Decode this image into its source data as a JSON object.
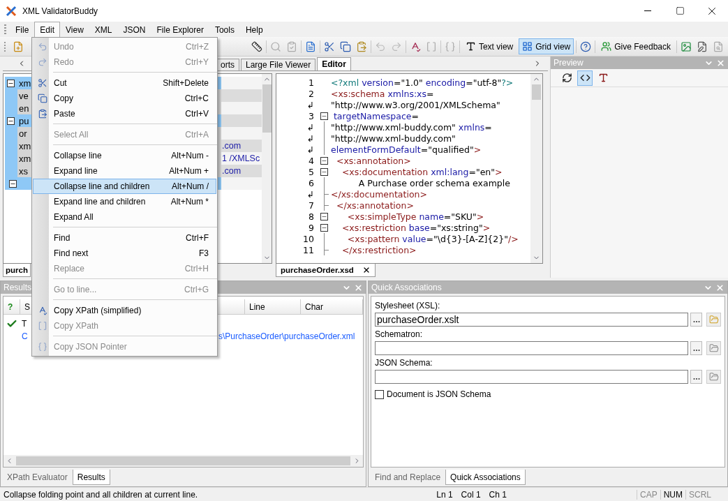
{
  "window": {
    "title": "XML ValidatorBuddy"
  },
  "menu_bar": [
    {
      "label": "File",
      "selected": false
    },
    {
      "label": "Edit",
      "selected": true
    },
    {
      "label": "View",
      "selected": false
    },
    {
      "label": "XML",
      "selected": false
    },
    {
      "label": "JSON",
      "selected": false
    },
    {
      "label": "File Explorer",
      "selected": false
    },
    {
      "label": "Tools",
      "selected": false
    },
    {
      "label": "Help",
      "selected": false
    }
  ],
  "edit_menu": {
    "items": [
      {
        "kind": "item",
        "label": "Undo",
        "shortcut": "Ctrl+Z",
        "disabled": true,
        "selected": false
      },
      {
        "kind": "item",
        "label": "Redo",
        "shortcut": "Ctrl+Y",
        "disabled": true,
        "selected": false
      },
      {
        "kind": "separator"
      },
      {
        "kind": "item",
        "label": "Cut",
        "shortcut": "Shift+Delete",
        "disabled": false,
        "selected": false
      },
      {
        "kind": "item",
        "label": "Copy",
        "shortcut": "Ctrl+C",
        "disabled": false,
        "selected": false
      },
      {
        "kind": "item",
        "label": "Paste",
        "shortcut": "Ctrl+V",
        "disabled": false,
        "selected": false
      },
      {
        "kind": "separator"
      },
      {
        "kind": "item",
        "label": "Select All",
        "shortcut": "Ctrl+A",
        "disabled": true,
        "selected": false
      },
      {
        "kind": "separator"
      },
      {
        "kind": "item",
        "label": "Collapse line",
        "shortcut": "Alt+Num -",
        "disabled": false,
        "selected": false
      },
      {
        "kind": "item",
        "label": "Expand line",
        "shortcut": "Alt+Num +",
        "disabled": false,
        "selected": false
      },
      {
        "kind": "item",
        "label": "Collapse line and children",
        "shortcut": "Alt+Num /",
        "disabled": false,
        "selected": true
      },
      {
        "kind": "item",
        "label": "Expand line and children",
        "shortcut": "Alt+Num *",
        "disabled": false,
        "selected": false
      },
      {
        "kind": "item",
        "label": "Expand All",
        "disabled": false,
        "selected": false
      },
      {
        "kind": "separator"
      },
      {
        "kind": "item",
        "label": "Find",
        "shortcut": "Ctrl+F",
        "disabled": false,
        "selected": false
      },
      {
        "kind": "item",
        "label": "Find next",
        "shortcut": "F3",
        "disabled": false,
        "selected": false
      },
      {
        "kind": "item",
        "label": "Replace",
        "shortcut": "Ctrl+H",
        "disabled": true,
        "selected": false
      },
      {
        "kind": "separator"
      },
      {
        "kind": "item",
        "label": "Go to line...",
        "shortcut": "Ctrl+G",
        "disabled": true,
        "selected": false
      },
      {
        "kind": "separator"
      },
      {
        "kind": "item",
        "label": "Copy XPath (simplified)",
        "disabled": false,
        "selected": false
      },
      {
        "kind": "item",
        "label": "Copy XPath",
        "disabled": true,
        "selected": false
      },
      {
        "kind": "separator"
      },
      {
        "kind": "item",
        "label": "Copy JSON Pointer",
        "disabled": true,
        "selected": false
      }
    ]
  },
  "toolbar": {
    "buttons": [
      {
        "label": "Text view",
        "pressed": false
      },
      {
        "label": "Grid view",
        "pressed": true
      },
      {
        "label": "Give Feedback",
        "pressed": false
      }
    ]
  },
  "document_tabs": [
    {
      "label": "orts",
      "selected": false
    },
    {
      "label": "Large File Viewer",
      "selected": false
    },
    {
      "label": "Editor",
      "selected": true
    }
  ],
  "grid": {
    "tab": "purch",
    "rows": [
      {
        "kind": "element",
        "name": "xm",
        "expanded": true
      },
      {
        "kind": "attribute",
        "name": "ve"
      },
      {
        "kind": "attribute",
        "name": "en"
      },
      {
        "kind": "element",
        "name": "pu",
        "expanded": true
      },
      {
        "kind": "attribute",
        "name": "or"
      },
      {
        "kind": "attribute",
        "name": "xm",
        "value": ".com"
      },
      {
        "kind": "attribute",
        "name": "xm",
        "value": "1 /XMLSc"
      },
      {
        "kind": "attribute",
        "name": "xs",
        "value": ".com"
      },
      {
        "kind": "element",
        "expanded": true
      }
    ]
  },
  "editor": {
    "tab": "purchaseOrder.xsd",
    "lines": [
      {
        "number": "1",
        "kind": "plain",
        "segments": [
          {
            "kind": "pi",
            "text": "<?xml"
          },
          {
            "kind": "attr",
            "text": " version"
          },
          {
            "kind": "value",
            "text": "=\"1.0\""
          },
          {
            "kind": "attr",
            "text": " encoding"
          },
          {
            "kind": "value",
            "text": "=\"utf-8\""
          },
          {
            "kind": "pi",
            "text": "?>"
          }
        ]
      },
      {
        "number": "2",
        "kind": "plain",
        "segments": [
          {
            "kind": "tag",
            "text": "<xs:schema"
          },
          {
            "kind": "attr",
            "text": " xmlns:xs"
          },
          {
            "kind": "value",
            "text": "="
          }
        ]
      },
      {
        "number": "↲",
        "kind": "plain",
        "segments": [
          {
            "kind": "value",
            "text": "\"http://www.w3.org/2001/XMLSchema\""
          }
        ]
      },
      {
        "number": "3",
        "kind": "fold",
        "segments": [
          {
            "kind": "attr",
            "text": " targetNamespace"
          },
          {
            "kind": "value",
            "text": "="
          }
        ]
      },
      {
        "number": "↲",
        "kind": "inner",
        "segments": [
          {
            "kind": "value",
            "text": "\"http://www.xml-buddy.com\""
          },
          {
            "kind": "attr",
            "text": " xmlns"
          },
          {
            "kind": "value",
            "text": "="
          }
        ]
      },
      {
        "number": "↲",
        "kind": "inner",
        "segments": [
          {
            "kind": "value",
            "text": "\"http://www.xml-buddy.com\""
          }
        ]
      },
      {
        "number": "↲",
        "kind": "inner",
        "segments": [
          {
            "kind": "attr",
            "text": "elementFormDefault"
          },
          {
            "kind": "value",
            "text": "=\"qualified\""
          },
          {
            "kind": "tag",
            "text": ">"
          }
        ]
      },
      {
        "number": "4",
        "kind": "fold",
        "segments": [
          {
            "kind": "tag",
            "text": "  <xs:annotation>"
          }
        ]
      },
      {
        "number": "5",
        "kind": "fold",
        "segments": [
          {
            "kind": "tag",
            "text": "    <xs:documentation"
          },
          {
            "kind": "attr",
            "text": " xml:lang"
          },
          {
            "kind": "value",
            "text": "=\"en\""
          },
          {
            "kind": "tag",
            "text": ">"
          }
        ]
      },
      {
        "number": "6",
        "kind": "inner",
        "segments": [
          {
            "kind": "value",
            "text": "          A Purchase order schema example"
          }
        ]
      },
      {
        "number": "↲",
        "kind": "end",
        "segments": [
          {
            "kind": "tag",
            "text": "</xs:documentation>"
          }
        ]
      },
      {
        "number": "7",
        "kind": "end",
        "segments": [
          {
            "kind": "tag",
            "text": "  </xs:annotation>"
          }
        ]
      },
      {
        "number": "8",
        "kind": "fold",
        "segments": [
          {
            "kind": "tag",
            "text": "      <xs:simpleType"
          },
          {
            "kind": "attr",
            "text": " name"
          },
          {
            "kind": "value",
            "text": "=\"SKU\""
          },
          {
            "kind": "tag",
            "text": ">"
          }
        ]
      },
      {
        "number": "9",
        "kind": "fold",
        "segments": [
          {
            "kind": "tag",
            "text": "    <xs:restriction"
          },
          {
            "kind": "attr",
            "text": " base"
          },
          {
            "kind": "value",
            "text": "=\"xs:string\""
          },
          {
            "kind": "tag",
            "text": ">"
          }
        ]
      },
      {
        "number": "10",
        "kind": "inner",
        "segments": [
          {
            "kind": "tag",
            "text": "      <xs:pattern"
          },
          {
            "kind": "attr",
            "text": " value"
          },
          {
            "kind": "value",
            "text": "=\"\\d{3}-[A-Z]{2}\""
          },
          {
            "kind": "tag",
            "text": "/>"
          }
        ]
      },
      {
        "number": "11",
        "kind": "end",
        "segments": [
          {
            "kind": "tag",
            "text": "    </xs:restriction>"
          }
        ]
      }
    ]
  },
  "preview": {
    "title": "Preview",
    "buttons": [
      {
        "pressed": false
      },
      {
        "pressed": true
      },
      {
        "pressed": false
      }
    ]
  },
  "results": {
    "title": "Results",
    "columns": [
      "?",
      "S",
      "Line",
      "Char"
    ],
    "rows": [
      {
        "kind": "status",
        "ok": true,
        "message": "T"
      },
      {
        "kind": "detail",
        "message": "C",
        "path": "s\\PurchaseOrder\\purchaseOrder.xml"
      }
    ],
    "tabs": [
      {
        "label": "XPath Evaluator",
        "selected": false
      },
      {
        "label": "Results",
        "selected": true
      }
    ]
  },
  "quick_associations": {
    "title": "Quick Associations",
    "fields": [
      {
        "label": "Stylesheet (XSL):",
        "value": "purchaseOrder.xslt"
      },
      {
        "label": "Schematron:"
      },
      {
        "label": "JSON Schema:"
      }
    ],
    "checkbox": {
      "label": "Document is JSON Schema",
      "checked": false
    },
    "tabs": [
      {
        "label": "Find and Replace",
        "selected": false
      },
      {
        "label": "Quick Associations",
        "selected": true
      }
    ]
  },
  "status_bar": {
    "message": "Collapse folding point and all children at current line.",
    "position": [
      "Ln 1",
      "Col 1",
      "Ch 1"
    ],
    "indicators": [
      {
        "label": "CAP",
        "on": false
      },
      {
        "label": "NUM",
        "on": true
      },
      {
        "label": "SCRL",
        "on": false
      }
    ]
  }
}
